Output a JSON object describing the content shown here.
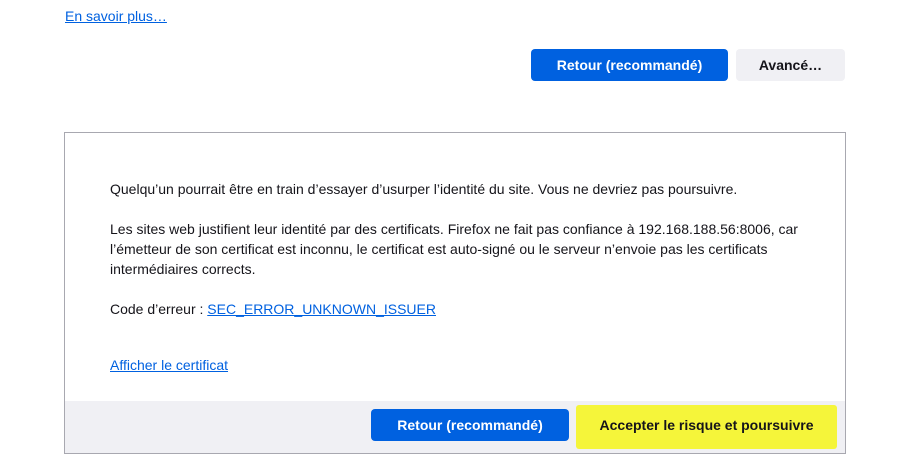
{
  "learn_more": "En savoir plus…",
  "top_actions": {
    "back_label": "Retour (recommandé)",
    "advanced_label": "Avancé…"
  },
  "advanced_panel": {
    "risk_text": "Quelqu’un pourrait être en train d’essayer d’usurper l’identité du site. Vous ne devriez pas poursuivre.",
    "explanation_text": "Les sites web justifient leur identité par des certificats. Firefox ne fait pas confiance à 192.168.188.56:8006, car l’émetteur de son certificat est inconnu, le certificat est auto-signé ou le serveur n’envoie pas les certificats intermédiaires corrects.",
    "error_label": "Code d’erreur : ",
    "error_code": "SEC_ERROR_UNKNOWN_ISSUER",
    "view_certificate": "Afficher le certificat",
    "back_label": "Retour (recommandé)",
    "accept_label": "Accepter le risque et poursuivre",
    "highlight_color": "#f5f53a"
  },
  "colors": {
    "primary": "#0061e0",
    "secondary_bg": "#f0f0f4",
    "text": "#15141a",
    "link": "#0061e0"
  }
}
